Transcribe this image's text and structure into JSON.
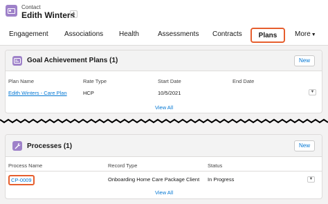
{
  "header": {
    "object_label": "Contact",
    "record_name": "Edith Winters",
    "hierarchy_glyph": "⋔"
  },
  "tabs": [
    {
      "label": "Engagement"
    },
    {
      "label": "Associations"
    },
    {
      "label": "Health"
    },
    {
      "label": "Assessments"
    },
    {
      "label": "Contracts"
    },
    {
      "label": "Plans",
      "active": true
    },
    {
      "label": "More"
    }
  ],
  "goal_plans": {
    "title": "Goal Achievement Plans (1)",
    "new_label": "New",
    "columns": [
      "Plan Name",
      "Rate Type",
      "Start Date",
      "End Date"
    ],
    "rows": [
      {
        "plan_name": "Edith Winters - Care Plan",
        "rate_type": "HCP",
        "start_date": "10/5/2021",
        "end_date": ""
      }
    ],
    "view_all": "View All"
  },
  "processes": {
    "title": "Processes (1)",
    "new_label": "New",
    "columns": [
      "Process Name",
      "Record Type",
      "Status"
    ],
    "rows": [
      {
        "process_name": "CP-0009",
        "record_type": "Onboarding Home Care Package Client",
        "status": "In Progress"
      }
    ],
    "view_all": "View All"
  },
  "colors": {
    "accent_highlight": "#e65e2d",
    "link": "#0176d3",
    "icon_purple": "#9e81c9"
  }
}
